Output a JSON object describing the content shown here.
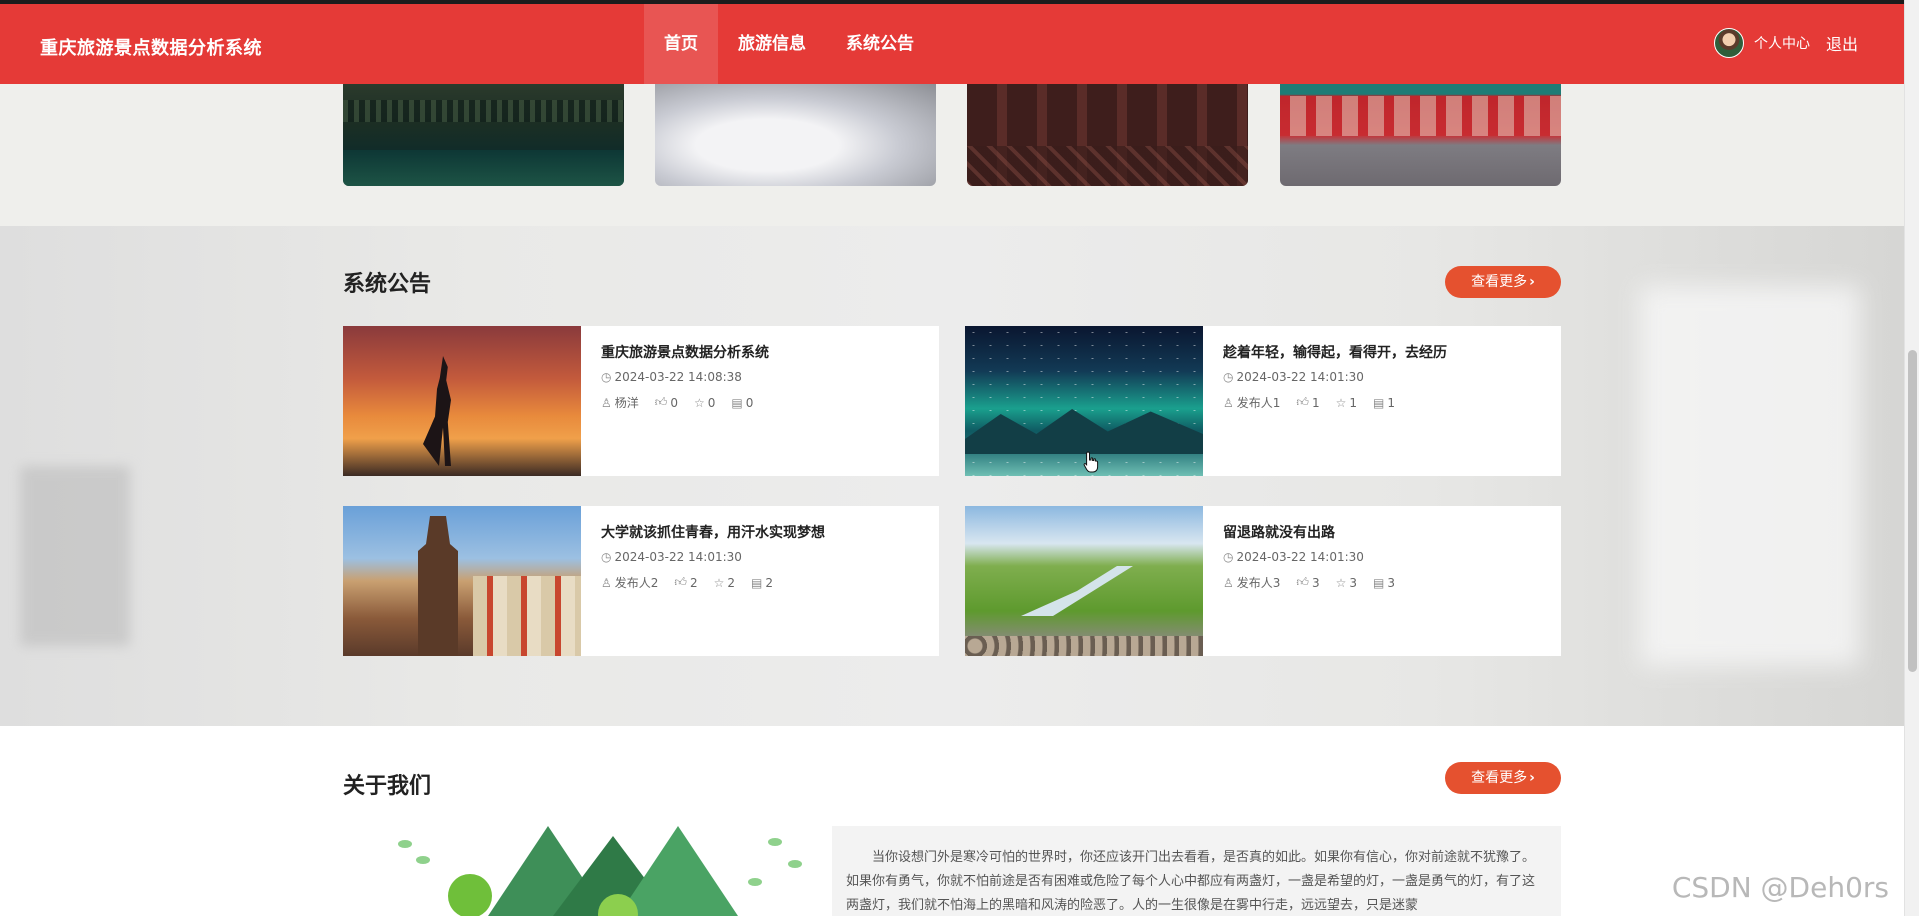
{
  "header": {
    "brand": "重庆旅游景点数据分析系统",
    "nav": [
      {
        "label": "首页",
        "active": true
      },
      {
        "label": "旅游信息",
        "active": false
      },
      {
        "label": "系统公告",
        "active": false
      }
    ],
    "user_center": "个人中心",
    "logout": "退出",
    "accent_color": "#e53a37"
  },
  "notice_section": {
    "title": "系统公告",
    "more_label": "查看更多",
    "cards": [
      {
        "title": "重庆旅游景点数据分析系统",
        "date": "2024-03-22 14:08:38",
        "author": "杨洋",
        "likes": "0",
        "favorites": "0",
        "comments": "0",
        "image": "sunset-silhouette"
      },
      {
        "title": "趁着年轻，输得起，看得开，去经历",
        "date": "2024-03-22 14:01:30",
        "author": "发布人1",
        "likes": "1",
        "favorites": "1",
        "comments": "1",
        "image": "aurora-lake"
      },
      {
        "title": "大学就该抓住青春，用汗水实现梦想",
        "date": "2024-03-22 14:01:30",
        "author": "发布人2",
        "likes": "2",
        "favorites": "2",
        "comments": "2",
        "image": "prague-old-town"
      },
      {
        "title": "留退路就没有出路",
        "date": "2024-03-22 14:01:30",
        "author": "发布人3",
        "likes": "3",
        "favorites": "3",
        "comments": "3",
        "image": "green-valley-river"
      }
    ]
  },
  "about_section": {
    "title": "关于我们",
    "more_label": "查看更多",
    "text": "当你设想门外是寒冷可怕的世界时，你还应该开门出去看看，是否真的如此。如果你有信心，你对前途就不犹豫了。如果你有勇气，你就不怕前途是否有困难或危险了每个人心中都应有两盏灯，一盏是希望的灯，一盏是勇气的灯，有了这两盏灯，我们就不怕海上的黑暗和风涛的险恶了。人的一生很像是在雾中行走，远远望去，只是迷蒙"
  },
  "watermark": "CSDN @Deh0rs"
}
